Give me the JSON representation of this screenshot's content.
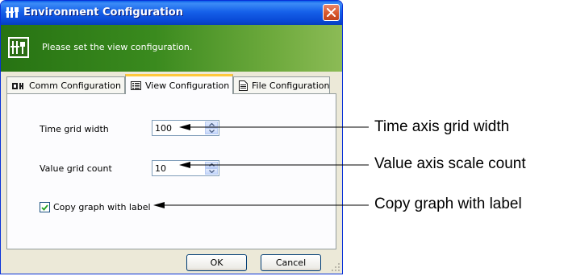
{
  "window": {
    "title": "Environment Configuration",
    "icon": "tool-icon",
    "title_color": "#0a5fe8"
  },
  "banner": {
    "text": "Please set the view configuration.",
    "icon": "config-icon",
    "color": "#3a8a1e"
  },
  "tabs": [
    {
      "label": "Comm Configuration",
      "icon": "comm-icon",
      "active": false
    },
    {
      "label": "View Configuration",
      "icon": "list-icon",
      "active": true
    },
    {
      "label": "File Configuration",
      "icon": "document-icon",
      "active": false
    }
  ],
  "form": {
    "time_grid": {
      "label": "Time grid width",
      "value": "100"
    },
    "value_grid": {
      "label": "Value grid count",
      "value": "10"
    },
    "copy_graph": {
      "label": "Copy graph with label",
      "checked": true
    }
  },
  "buttons": {
    "ok": "OK",
    "cancel": "Cancel"
  },
  "callouts": {
    "time": "Time axis grid width",
    "value": "Value axis scale count",
    "copy": "Copy graph with label"
  }
}
